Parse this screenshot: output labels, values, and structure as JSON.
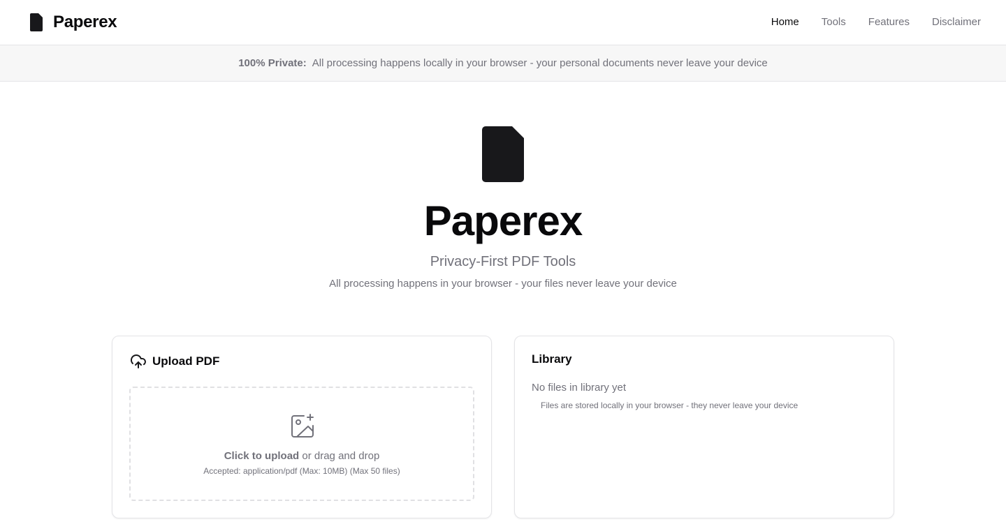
{
  "header": {
    "brand": "Paperex",
    "brand_icon": "document-icon",
    "nav": [
      {
        "label": "Home",
        "active": true
      },
      {
        "label": "Tools",
        "active": false
      },
      {
        "label": "Features",
        "active": false
      },
      {
        "label": "Disclaimer",
        "active": false
      }
    ]
  },
  "banner": {
    "strong": "100% Private:",
    "text": "All processing happens locally in your browser - your personal documents never leave your device"
  },
  "hero": {
    "icon": "document-icon",
    "title": "Paperex",
    "subtitle": "Privacy-First PDF Tools",
    "description": "All processing happens in your browser - your files never leave your device"
  },
  "upload": {
    "icon": "cloud-upload-icon",
    "title": "Upload PDF",
    "dropzone_icon": "image-plus-icon",
    "click_label": "Click to upload",
    "drag_label": "or drag and drop",
    "hint": "Accepted: application/pdf (Max: 10MB) (Max 50 files)"
  },
  "library": {
    "title": "Library",
    "empty": "No files in library yet",
    "note": "Files are stored locally in your browser - they never leave your device"
  },
  "colors": {
    "primary_text": "#09090b",
    "muted_text": "#71717a",
    "border": "#e4e4e7",
    "banner_bg": "#f7f7f7"
  }
}
